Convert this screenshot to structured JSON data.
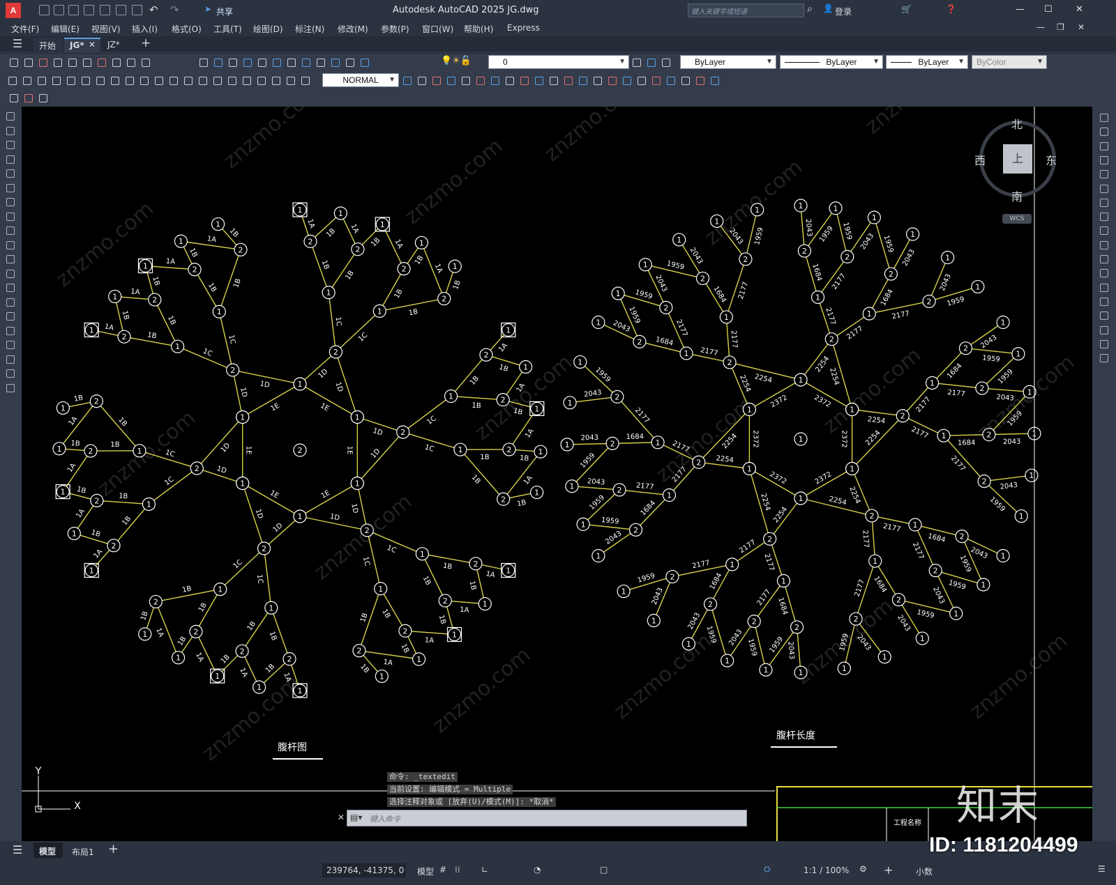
{
  "app": {
    "window_title": "Autodesk AutoCAD 2025    JG.dwg",
    "share_label": "共享",
    "search_placeholder": "键入关键字或短语",
    "login_label": "登录"
  },
  "menu": [
    "文件(F)",
    "编辑(E)",
    "视图(V)",
    "插入(I)",
    "格式(O)",
    "工具(T)",
    "绘图(D)",
    "标注(N)",
    "修改(M)",
    "参数(P)",
    "窗口(W)",
    "帮助(H)",
    "Express"
  ],
  "doc_tabs": [
    "开始",
    "JG*",
    "JZ*"
  ],
  "toolbar": {
    "layer_value": "0",
    "color_value": "ByLayer",
    "linetype_value": "ByLayer",
    "lineweight_value": "ByLayer",
    "plotstyle_value": "ByColor",
    "visual_style": "NORMAL"
  },
  "viewcube": {
    "north": "北",
    "south": "南",
    "east": "东",
    "west": "西",
    "top": "上",
    "wcs": "WCS"
  },
  "drawing": {
    "left_title": "腹杆图",
    "right_title": "腹杆长度",
    "ucs_x": "X",
    "ucs_y": "Y",
    "titleblock_label": "工程名称",
    "left_labels": [
      "1",
      "2",
      "1A",
      "1B",
      "1C",
      "1D",
      "1E"
    ],
    "right_lengths": [
      "2043",
      "1959",
      "1684",
      "2177",
      "2254",
      "2372"
    ]
  },
  "command": {
    "history": [
      "命令: _textedit",
      "当前设置: 编辑模式 = Multiple",
      "选择注释对象或 [放弃(U)/模式(M)]: *取消*"
    ],
    "placeholder": "键入命令"
  },
  "layout_tabs": [
    "模型",
    "布局1"
  ],
  "status": {
    "coords": "239764, -41375, 0",
    "model_label": "模型",
    "scale": "1:1 / 100%",
    "units": "小数"
  },
  "watermark": {
    "site": "znzmo.com",
    "brand": "知末",
    "id_text": "ID: 1181204499"
  },
  "colors": {
    "yellow_lines": "#d8d24a",
    "white_strokes": "#ffffff",
    "canvas_bg": "#000000",
    "ui_dark": "#2b3240",
    "accent_red": "#e03a3a",
    "accent_blue": "#5aa0e6"
  }
}
